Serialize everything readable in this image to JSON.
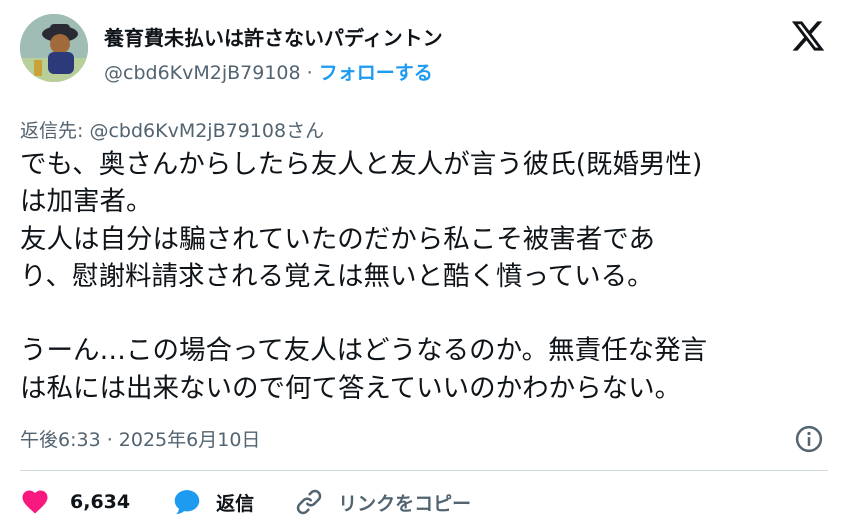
{
  "author": {
    "name": "養育費未払いは許さないパディントン",
    "handle": "@cbd6KvM2jB79108",
    "separator": "·",
    "follow_label": "フォローする"
  },
  "reply_to": {
    "prefix": "返信先: ",
    "handle": "@cbd6KvM2jB79108",
    "suffix": "さん"
  },
  "post": {
    "text": "でも、奥さんからしたら友人と友人が言う彼氏(既婚男性)\nは加害者。\n友人は自分は騙されていたのだから私こそ被害者であ\nり、慰謝料請求される覚えは無いと酷く憤っている。\n\nうーん…この場合って友人はどうなるのか。無責任な発言\nは私には出来ないので何て答えていいのかわからない。"
  },
  "timestamp": "午後6:33 · 2025年6月10日",
  "actions": {
    "like_count": "6,634",
    "reply_label": "返信",
    "copy_link_label": "リンクをコピー"
  },
  "colors": {
    "text": "#0f1419",
    "secondary": "#536471",
    "accent": "#1d9bf0",
    "like": "#f91880"
  },
  "icons": [
    "x-logo-icon",
    "info-icon",
    "heart-icon",
    "reply-bubble-icon",
    "link-icon"
  ]
}
